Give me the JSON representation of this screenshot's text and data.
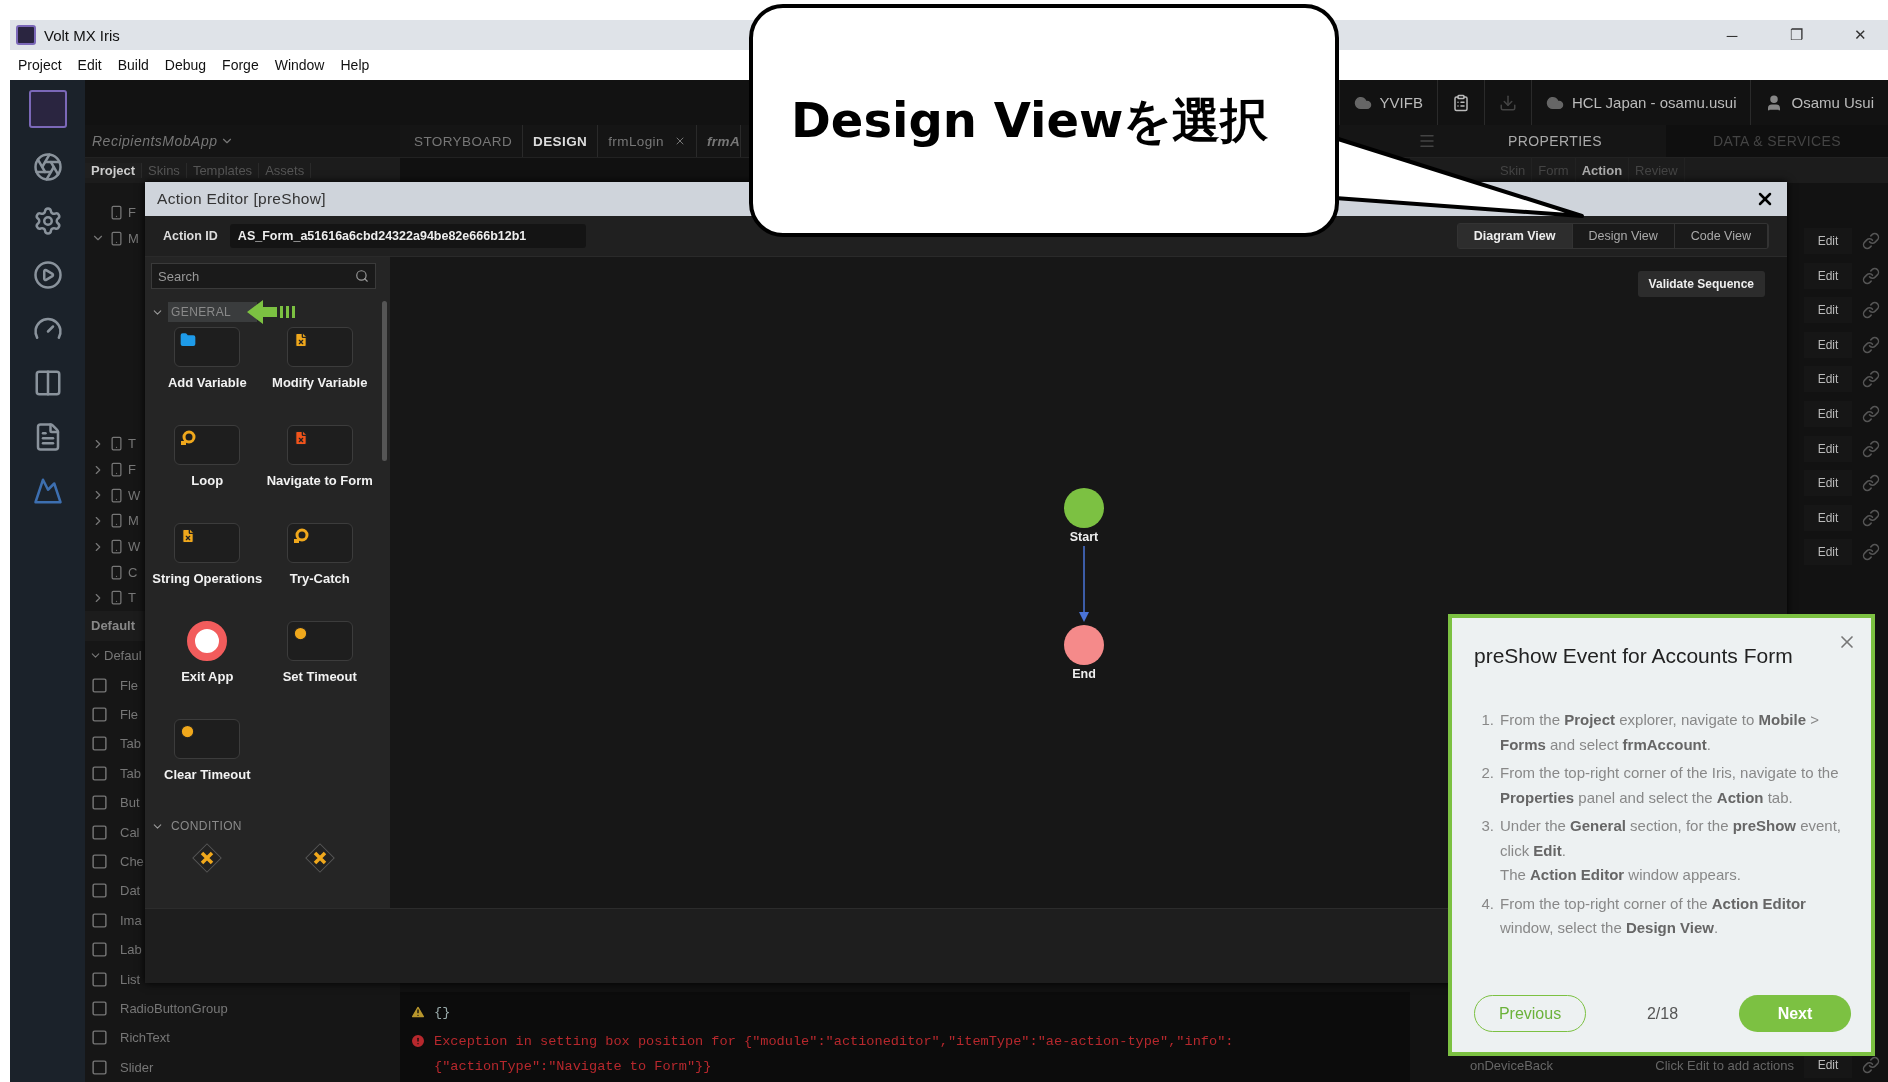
{
  "window": {
    "title": "Volt MX Iris",
    "controls": [
      "─",
      "❐",
      "✕"
    ]
  },
  "menu": [
    "Project",
    "Edit",
    "Build",
    "Debug",
    "Forge",
    "Window",
    "Help"
  ],
  "header": {
    "items": [
      {
        "kind": "cloud",
        "label": "YVIFB"
      },
      {
        "kind": "clipboard"
      },
      {
        "kind": "download"
      },
      {
        "kind": "cloud",
        "label": "HCL Japan - osamu.usui"
      },
      {
        "kind": "user",
        "label": "Osamu Usui"
      }
    ]
  },
  "explorer": {
    "app": "RecipientsMobApp",
    "tabs": [
      {
        "label": "Project",
        "selected": true
      },
      {
        "label": "Skins",
        "selected": false
      },
      {
        "label": "Templates",
        "selected": false
      },
      {
        "label": "Assets",
        "selected": false
      }
    ],
    "tree": [
      {
        "label": "F"
      },
      {
        "label": "M",
        "expanded": true
      },
      {
        "label": "T",
        "expanded": false
      },
      {
        "label": "F",
        "expanded": false
      },
      {
        "label": "W",
        "expanded": false
      },
      {
        "label": "M",
        "expanded": false
      },
      {
        "label": "W",
        "expanded": false
      },
      {
        "label": "C"
      },
      {
        "label": "T",
        "expanded": false
      }
    ],
    "section": "Default",
    "group": "Defaul",
    "components": [
      "Fle",
      "Fle",
      "Tab",
      "Tab",
      "But",
      "Cal",
      "Che",
      "Dat",
      "Ima",
      "Lab",
      "List",
      "RadioButtonGroup",
      "RichText",
      "Slider"
    ]
  },
  "editor_tabs": [
    {
      "label": "STORYBOARD",
      "selected": false,
      "kind": "view"
    },
    {
      "label": "DESIGN",
      "selected": true,
      "kind": "view"
    },
    {
      "label": "frmLogin",
      "selected": false,
      "kind": "form"
    },
    {
      "label": "frmA",
      "selected": false,
      "kind": "current"
    }
  ],
  "console": [
    {
      "kind": "warning",
      "text": "{}"
    },
    {
      "kind": "error",
      "text": "Exception in setting box position for {\"module\":\"actioneditor\",\"itemType\":\"ae-action-type\",\"info\":{\"actionType\":\"Navigate to Form\"}}"
    }
  ],
  "properties": {
    "tabs": [
      {
        "label": "PROPERTIES",
        "selected": true
      },
      {
        "label": "DATA & SERVICES",
        "selected": false
      }
    ],
    "subtabs": [
      {
        "label": "Skin",
        "selected": false
      },
      {
        "label": "Form",
        "selected": false
      },
      {
        "label": "Action",
        "selected": true
      },
      {
        "label": "Review",
        "selected": false
      }
    ],
    "rows": [
      "Edit",
      "Edit",
      "Edit",
      "Edit",
      "Edit",
      "Edit",
      "Edit",
      "Edit",
      "Edit",
      "Edit"
    ],
    "last_row": {
      "event": "onDeviceBack",
      "hint": "Click Edit to add actions",
      "button": "Edit"
    }
  },
  "action_editor": {
    "title": "Action Editor [preShow]",
    "action_id_label": "Action ID",
    "action_id": "AS_Form_a51616a6cbd24322a94be82e666b12b1",
    "views": [
      {
        "label": "Diagram View",
        "selected": true
      },
      {
        "label": "Design View",
        "selected": false
      },
      {
        "label": "Code View",
        "selected": false
      }
    ],
    "search": {
      "placeholder": "Search"
    },
    "sections": [
      {
        "title": "GENERAL",
        "expanded": true,
        "highlighted": true,
        "items": [
          {
            "label": "Add Variable",
            "kind": "folder",
            "color": "#1e9be9"
          },
          {
            "label": "Modify Variable",
            "kind": "document",
            "color": "#f0a81c"
          },
          {
            "label": "Loop",
            "kind": "loop",
            "color": "#f0a81c"
          },
          {
            "label": "Navigate to Form",
            "kind": "document",
            "color": "#f2541b"
          },
          {
            "label": "String Operations",
            "kind": "document",
            "color": "#f0a81c"
          },
          {
            "label": "Try-Catch",
            "kind": "loop",
            "color": "#f0a81c"
          },
          {
            "label": "Exit App",
            "kind": "exit",
            "color": "#f25c5c"
          },
          {
            "label": "Set Timeout",
            "kind": "timer",
            "color": "#f0a81c"
          },
          {
            "label": "Clear Timeout",
            "kind": "timer",
            "color": "#f0a81c"
          }
        ]
      },
      {
        "title": "CONDITION",
        "expanded": true,
        "highlighted": false,
        "items": [
          {
            "kind": "condition",
            "color": "#f0a81c"
          },
          {
            "kind": "condition",
            "color": "#f0a81c"
          }
        ]
      }
    ],
    "validate": "Validate Sequence",
    "nodes": [
      {
        "label": "Start",
        "kind": "start"
      },
      {
        "label": "End",
        "kind": "end"
      }
    ]
  },
  "callout": {
    "text": "Design Viewを選択"
  },
  "tour": {
    "title": "preShow Event for Accounts Form",
    "steps": [
      {
        "number": "1.",
        "text": "From the **Project** explorer, navigate to **Mobile** > **Forms** and select **frmAccount**."
      },
      {
        "number": "2.",
        "text": "From the top-right corner of the Iris, navigate to the **Properties** panel and select the **Action** tab."
      },
      {
        "number": "3.",
        "text": "Under the **General** section, for the **preShow** event, click **Edit**.",
        "note": "The **Action Editor** window appears."
      },
      {
        "number": "4.",
        "text": "From the top-right corner of the **Action Editor** window, select the **Design View**."
      }
    ],
    "previous": "Previous",
    "progress": "2/18",
    "next": "Next"
  }
}
